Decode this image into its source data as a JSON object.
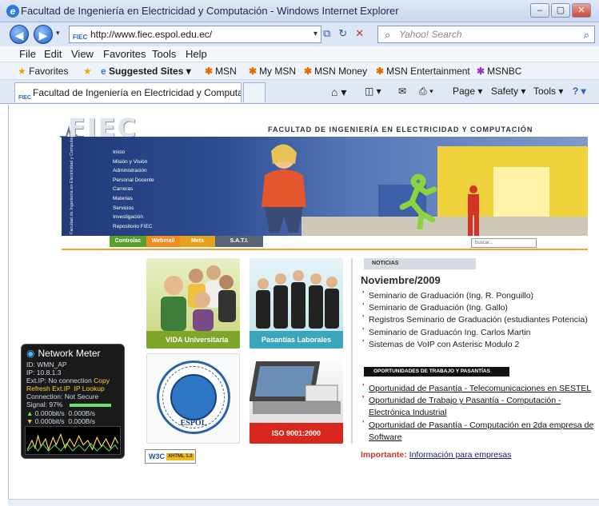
{
  "window": {
    "title": "Facultad de Ingeniería en Electricidad y Computación - Windows Internet Explorer"
  },
  "address": {
    "url": "http://www.fiec.espol.edu.ec/",
    "favicon": "FIEC"
  },
  "search": {
    "placeholder": "Yahoo! Search"
  },
  "menu": [
    "File",
    "Edit",
    "View",
    "Favorites",
    "Tools",
    "Help"
  ],
  "favorites_bar": {
    "favorites": "Favorites",
    "suggested": "Suggested Sites ▾",
    "links": [
      "MSN",
      "My MSN",
      "MSN Money",
      "MSN Entertainment",
      "MSNBC"
    ]
  },
  "tab": {
    "title": "Facultad de Ingeniería en Electricidad y Computa..."
  },
  "command_bar": {
    "page": "Page ▾",
    "safety": "Safety ▾",
    "tools": "Tools ▾"
  },
  "site": {
    "logo": "FIEC",
    "faculty": "FACULTAD DE INGENIERÍA EN ELECTRICIDAD Y COMPUTACIÓN",
    "vertical_text": "Facultad de Ingeniería en Electricidad y Computación",
    "side_menu": [
      "Inicio",
      "Misión y Visión",
      "Administración",
      "Personal Docente",
      "Carreras",
      "Materias",
      "Servicios",
      "Investigación",
      "Repositorio FIEC"
    ],
    "banner_tabs": [
      {
        "label": "Controlac",
        "color": "#5aa02c"
      },
      {
        "label": "Webmail",
        "color": "#f28c1e"
      },
      {
        "label": "Mets",
        "color": "#e6a21a"
      },
      {
        "label": "S.A.T.I.",
        "color": "#5a6472"
      }
    ],
    "banner_search": "buscar...",
    "tiles": [
      {
        "caption": "VIDA Universitaria"
      },
      {
        "caption": "Pasantías Laborales"
      },
      {
        "caption": "ESPOL"
      },
      {
        "caption": "ISO 9001:2000"
      }
    ],
    "seal_ring": "ESCUELA SUPERIOR POLITÉCNICA DEL LITORAL",
    "w3c": "W3C",
    "w3c_badge": "XHTML 1.0"
  },
  "news": {
    "header": "NOTICIAS",
    "month": "Noviembre/2009",
    "items": [
      "Seminario de Graduación (Ing. R. Ponguillo)",
      "Seminario de Graduación (Ing. Gallo)",
      "Registros Seminario de Graduación (estudiantes Potencia)",
      "Seminario de Graduacón Ing. Carlos Martin",
      "Sistemas de VoIP con Asterisc Modulo 2"
    ],
    "opp_header": "OPORTUNIDADES DE TRABAJO Y PASANTÍAS",
    "opportunities": [
      "Oportunidad de Pasantía - Telecomunicaciones en SESTEL",
      "Oportunidad de Trabajo y Pasantía - Computación - Electrónica Industrial",
      "Oportunidad de Pasantía - Computación en 2da empresa de Software"
    ],
    "important_label": "Importante:",
    "important_link": "Información para empresas"
  },
  "gadget": {
    "title": "Network Meter",
    "id": "ID: WMN_AP",
    "ip": "IP: 10.8.1.3",
    "ext_ip": "Ext.IP: No connection",
    "copy": "Copy",
    "refresh": "Refresh Ext.IP",
    "lookup": "IP Lookup",
    "connection": "Connection: Not Secure",
    "signal": "Signal: 97%",
    "up": "0.000bit/s",
    "up_b": "0.000B/s",
    "down": "0.000bit/s",
    "down_b": "0.000B/s"
  }
}
